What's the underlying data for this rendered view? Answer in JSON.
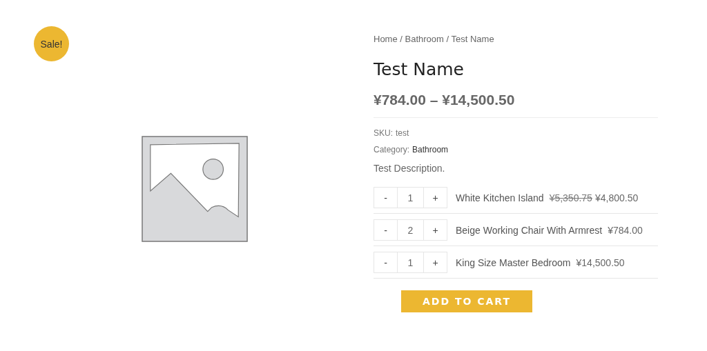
{
  "badge": "Sale!",
  "breadcrumb": "Home / Bathroom / Test Name",
  "title": "Test Name",
  "price_range": "¥784.00 – ¥14,500.50",
  "meta": [
    {
      "label": "SKU:",
      "value": "test",
      "kind": "plain"
    },
    {
      "label": "Category:",
      "value": "Bathroom",
      "kind": "link"
    }
  ],
  "description": "Test Description.",
  "items": [
    {
      "minus": "-",
      "qty": "1",
      "plus": "+",
      "name": "White Kitchen Island",
      "old_price": "¥5,350.75",
      "price": "¥4,800.50"
    },
    {
      "minus": "-",
      "qty": "2",
      "plus": "+",
      "name": "Beige Working Chair With Armrest",
      "price": "¥784.00"
    },
    {
      "minus": "-",
      "qty": "1",
      "plus": "+",
      "name": "King Size Master Bedroom",
      "price": "¥14,500.50"
    }
  ],
  "button": "ADD TO CART"
}
